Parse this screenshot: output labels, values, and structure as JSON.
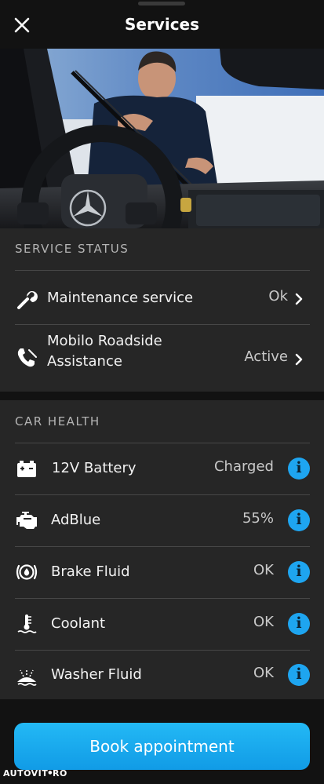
{
  "header": {
    "title": "Services"
  },
  "icons": {
    "close": "close-icon",
    "maintenance": "wrench-icon",
    "roadside": "phone-wrench-icon",
    "battery": "battery-icon",
    "adblue": "engine-icon",
    "brake": "brake-fluid-icon",
    "coolant": "thermometer-icon",
    "washer": "washer-fluid-icon",
    "info": "info-icon",
    "chevron": "chevron-right-icon"
  },
  "colors": {
    "accent": "#1ea5f0",
    "card": "#262626",
    "background": "#121212"
  },
  "service_status": {
    "title": "SERVICE STATUS",
    "items": [
      {
        "label": "Maintenance service",
        "value": "Ok"
      },
      {
        "label_line1": "Mobilo Roadside",
        "label_line2": "Assistance",
        "value": "Active"
      }
    ]
  },
  "car_health": {
    "title": "CAR HEALTH",
    "items": [
      {
        "label": "12V Battery",
        "value": "Charged"
      },
      {
        "label": "AdBlue",
        "value": "55%"
      },
      {
        "label": "Brake Fluid",
        "value": "OK"
      },
      {
        "label": "Coolant",
        "value": "OK"
      },
      {
        "label": "Washer Fluid",
        "value": "OK"
      }
    ]
  },
  "info_glyph": "i",
  "book_button": {
    "label": "Book appointment"
  },
  "watermark": {
    "name": "AUTOVIT",
    "suffix": "RO"
  }
}
